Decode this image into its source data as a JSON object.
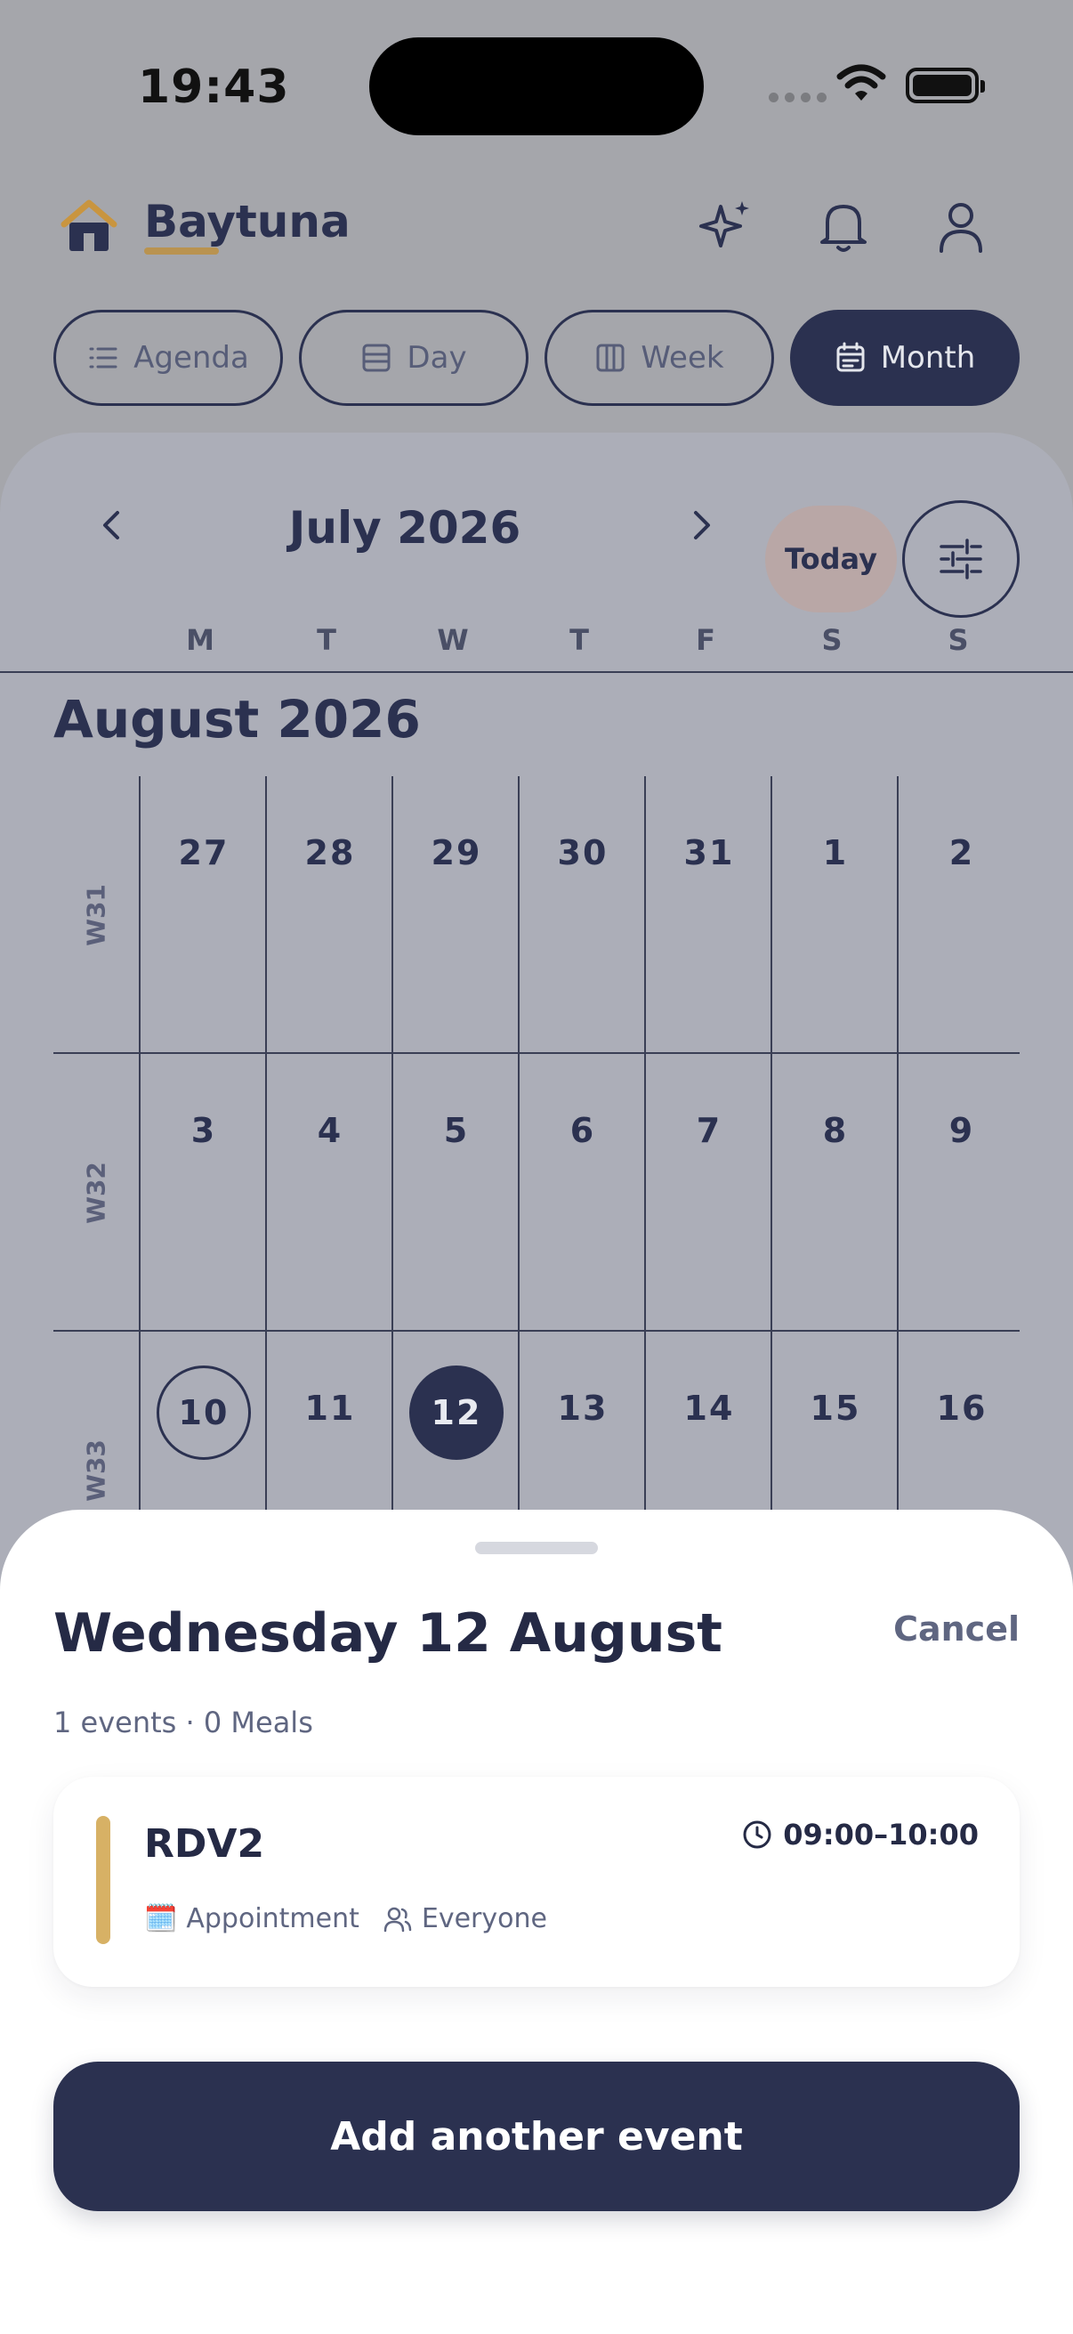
{
  "status_bar": {
    "time": "19:43"
  },
  "header": {
    "brand": "Baytuna"
  },
  "view_tabs": [
    {
      "label": "Agenda",
      "icon": "list-icon",
      "active": false
    },
    {
      "label": "Day",
      "icon": "day-view-icon",
      "active": false
    },
    {
      "label": "Week",
      "icon": "week-view-icon",
      "active": false
    },
    {
      "label": "Month",
      "icon": "calendar-icon",
      "active": true
    }
  ],
  "calendar": {
    "nav_title": "July 2026",
    "today_label": "Today",
    "weekdays": [
      "M",
      "T",
      "W",
      "T",
      "F",
      "S",
      "S"
    ],
    "month_title": "August 2026",
    "weeks": [
      {
        "label": "W31",
        "days": [
          "27",
          "28",
          "29",
          "30",
          "31",
          "1",
          "2"
        ]
      },
      {
        "label": "W32",
        "days": [
          "3",
          "4",
          "5",
          "6",
          "7",
          "8",
          "9"
        ]
      },
      {
        "label": "W33",
        "days": [
          "10",
          "11",
          "12",
          "13",
          "14",
          "15",
          "16"
        ]
      }
    ],
    "today_day": "10",
    "selected_day": "12"
  },
  "sheet": {
    "title": "Wednesday 12 August",
    "cancel_label": "Cancel",
    "summary": "1 events · 0 Meals",
    "event": {
      "title": "RDV2",
      "time": "09:00–10:00",
      "category": "Appointment",
      "category_icon": "🗓️",
      "audience": "Everyone",
      "accent_color": "#d7b165"
    },
    "add_label": "Add another event"
  },
  "colors": {
    "primary": "#2b3150",
    "accent": "#b99350",
    "overlay": "#a5a6ab"
  }
}
